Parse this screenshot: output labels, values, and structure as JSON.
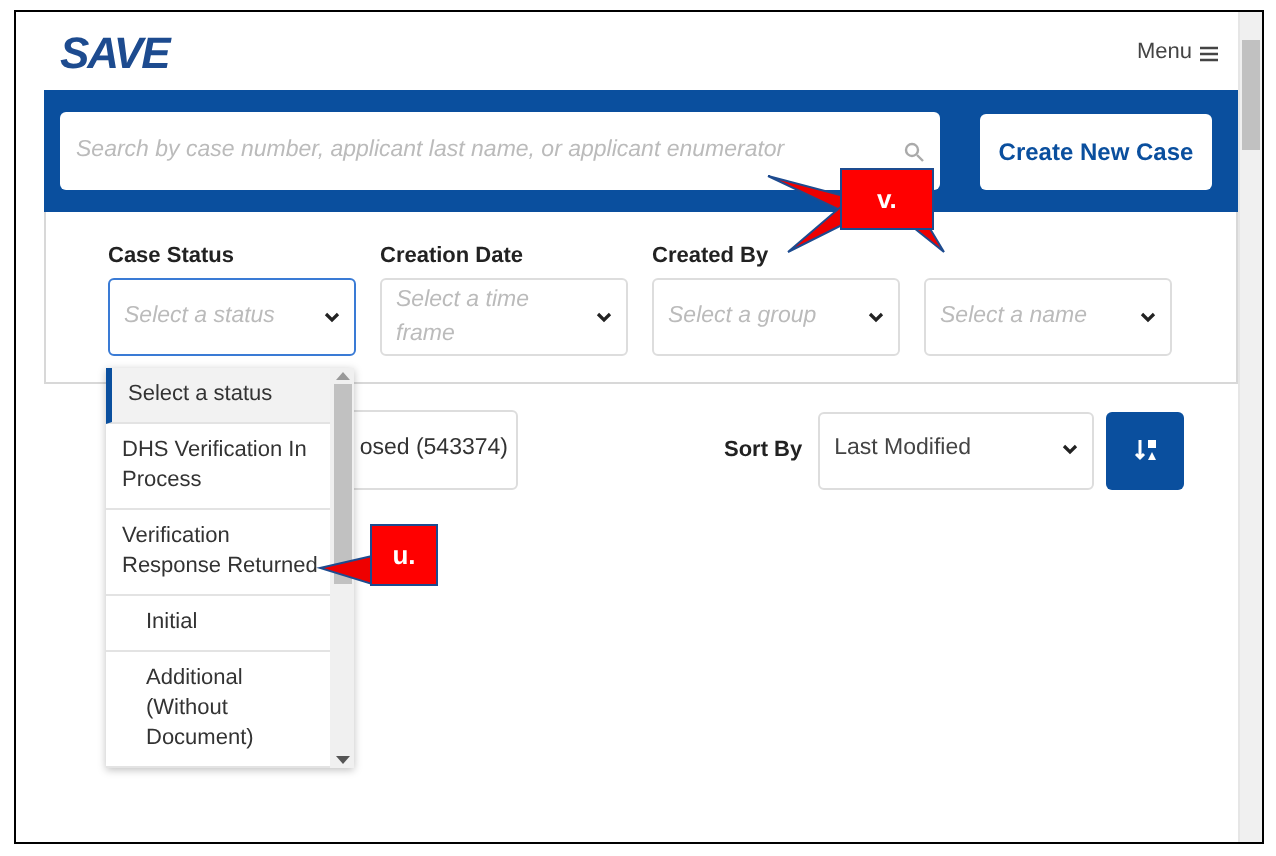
{
  "header": {
    "logo": "SAVE",
    "menu": "Menu"
  },
  "search": {
    "placeholder": "Search by case number, applicant last name, or applicant enumerator"
  },
  "create_button": "Create New Case",
  "filters": [
    {
      "label": "Case Status",
      "placeholder": "Select a status",
      "focused": true
    },
    {
      "label": "Creation Date",
      "placeholder": "Select a time frame",
      "focused": false
    },
    {
      "label": "Created By",
      "placeholder": "Select a group",
      "focused": false
    },
    {
      "placeholder": "Select a name",
      "focused": false
    }
  ],
  "status_dropdown": {
    "options": [
      {
        "label": "Select a status",
        "selected": true,
        "indent": false
      },
      {
        "label": "DHS Verification In Process",
        "selected": false,
        "indent": false
      },
      {
        "label": "Verification Response Returned",
        "selected": false,
        "indent": false
      },
      {
        "label": "Initial",
        "selected": false,
        "indent": true
      },
      {
        "label": "Additional (Without Document)",
        "selected": false,
        "indent": true
      }
    ]
  },
  "closed_button": "osed (543374)",
  "sort": {
    "label": "Sort By",
    "value": "Last Modified"
  },
  "callouts": [
    "v.",
    "u."
  ]
}
